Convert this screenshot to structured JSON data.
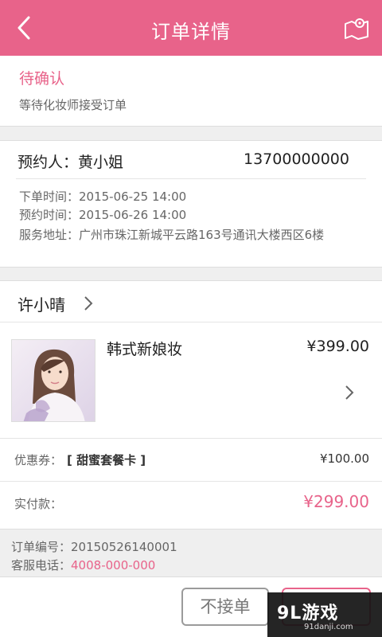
{
  "header": {
    "title": "订单详情",
    "back_icon": "chevron-left-icon",
    "map_icon": "map-pin-icon"
  },
  "status": {
    "title": "待确认",
    "desc": "等待化妆师接受订单"
  },
  "booking": {
    "booker": "预约人：黄小姐",
    "phone": "13700000000",
    "order_time": "下单时间：2015-06-25 14:00",
    "appointment_time": "预约时间：2015-06-26 14:00",
    "address": "服务地址：广州市珠江新城平云路163号通讯大楼西区6楼"
  },
  "artist": {
    "name": "许小晴"
  },
  "product": {
    "name": "韩式新娘妆",
    "price": "¥399.00"
  },
  "coupon": {
    "label": "优惠券：",
    "name": "[ 甜蜜套餐卡 ]",
    "value": "¥100.00"
  },
  "payment": {
    "label": "实付款：",
    "value": "¥299.00"
  },
  "order": {
    "number_line": "订单编号：20150526140001",
    "hotline_label": "客服电话：",
    "hotline": "4008-000-000"
  },
  "actions": {
    "reject": "不接单"
  },
  "watermark": {
    "text": "9L游戏",
    "sub": "91danji.com"
  },
  "colors": {
    "accent": "#e8638a",
    "background": "#efefef"
  }
}
